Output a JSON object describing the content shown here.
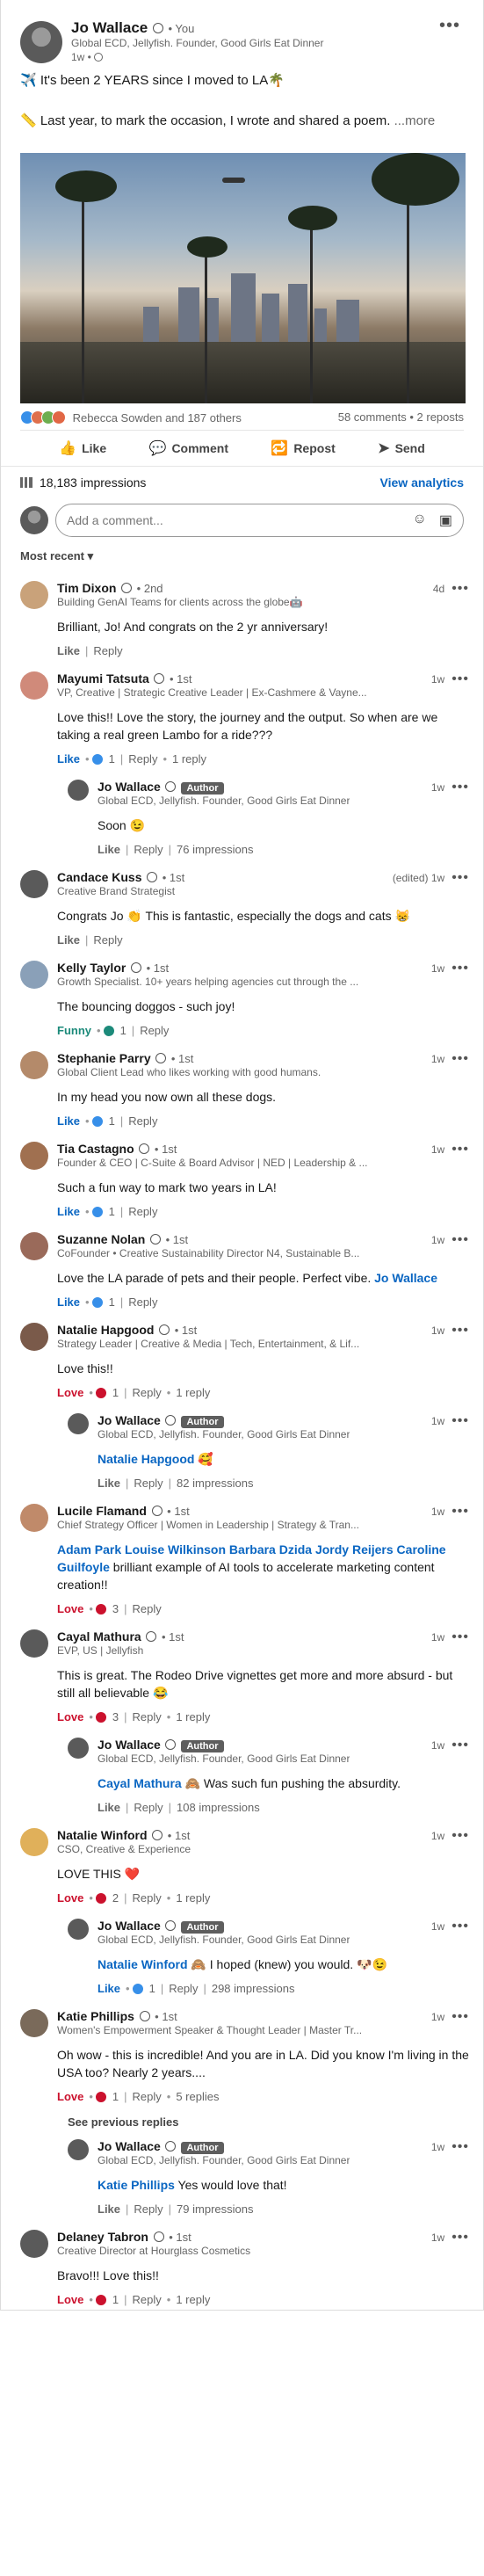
{
  "post": {
    "author": "Jo Wallace",
    "you": "• You",
    "headline": "Global ECD, Jellyfish. Founder, Good Girls Eat Dinner",
    "time": "1w •",
    "line1": "✈️ It's been 2 YEARS since I moved to LA🌴",
    "line2": "📏 Last year, to mark the occasion, I wrote and shared a poem.",
    "more": "...more",
    "reactions_text": "Rebecca Sowden and 187 others",
    "comments_reposts": "58 comments • 2 reposts",
    "actions": {
      "like": "Like",
      "comment": "Comment",
      "repost": "Repost",
      "send": "Send"
    },
    "impressions": "18,183 impressions",
    "view_analytics": "View analytics",
    "add_comment_placeholder": "Add a comment...",
    "sort": "Most recent ▾"
  },
  "colors": {
    "accent": "#0a66c2",
    "love": "#cb112d"
  },
  "comments": [
    {
      "name": "Tim Dixon",
      "deg": "• 2nd",
      "headline": "Building GenAI Teams for clients across the globe🤖",
      "time": "4d",
      "text": "Brilliant, Jo! And congrats on the 2 yr anniversary!",
      "react": "Like",
      "reply": "Reply"
    },
    {
      "name": "Mayumi Tatsuta",
      "deg": "• 1st",
      "headline": "VP, Creative | Strategic Creative Leader | Ex-Cashmere & Vayne...",
      "time": "1w",
      "text": "Love this!! Love the story, the journey and the output. So when are we taking a real green Lambo for a ride???",
      "react": "Like",
      "count": "1",
      "reply": "Reply",
      "replies": "1 reply"
    },
    {
      "name": "Jo Wallace",
      "badge": "Author",
      "headline": "Global ECD, Jellyfish. Founder, Good Girls Eat Dinner",
      "time": "1w",
      "text": "Soon 😉",
      "react": "Like",
      "reply": "Reply",
      "impressions": "76 impressions"
    },
    {
      "name": "Candace Kuss",
      "deg": "• 1st",
      "headline": "Creative Brand Strategist",
      "time": "(edited) 1w",
      "text": "Congrats Jo 👏 This is fantastic, especially the dogs and cats 😸",
      "react": "Like",
      "reply": "Reply"
    },
    {
      "name": "Kelly Taylor",
      "deg": "• 1st",
      "headline": "Growth Specialist. 10+ years helping agencies cut through the ...",
      "time": "1w",
      "text": "The bouncing doggos - such joy!",
      "react": "Funny",
      "count": "1",
      "reply": "Reply"
    },
    {
      "name": "Stephanie Parry",
      "deg": "• 1st",
      "headline": "Global Client Lead who likes working with good humans.",
      "time": "1w",
      "text": "In my head you now own all these dogs.",
      "react": "Like",
      "count": "1",
      "reply": "Reply"
    },
    {
      "name": "Tia Castagno",
      "deg": "• 1st",
      "headline": "Founder & CEO | C-Suite & Board Advisor | NED | Leadership & ...",
      "time": "1w",
      "text": "Such a fun way to mark two years in LA!",
      "react": "Like",
      "count": "1",
      "reply": "Reply"
    },
    {
      "name": "Suzanne Nolan",
      "deg": "• 1st",
      "headline": "CoFounder • Creative Sustainability Director N4, Sustainable B...",
      "time": "1w",
      "text": "Love the LA parade of pets and their people. Perfect vibe.",
      "mention": "Jo Wallace",
      "react": "Like",
      "count": "1",
      "reply": "Reply"
    },
    {
      "name": "Natalie Hapgood",
      "deg": "• 1st",
      "headline": "Strategy Leader | Creative & Media | Tech, Entertainment, & Lif...",
      "time": "1w",
      "text": "Love this!!",
      "react": "Love",
      "count": "1",
      "reply": "Reply",
      "replies": "1 reply"
    },
    {
      "name": "Jo Wallace",
      "badge": "Author",
      "headline": "Global ECD, Jellyfish. Founder, Good Girls Eat Dinner",
      "time": "1w",
      "mention": "Natalie Hapgood",
      "text": " 🥰",
      "react": "Like",
      "reply": "Reply",
      "impressions": "82 impressions"
    },
    {
      "name": "Lucile Flamand",
      "deg": "• 1st",
      "headline": "Chief Strategy Officer | Women in Leadership | Strategy & Tran...",
      "time": "1w",
      "mention": "Adam Park Louise Wilkinson Barbara Dzida Jordy Reijers Caroline Guilfoyle",
      "text": " brilliant example of AI tools to accelerate marketing content creation!!",
      "react": "Love",
      "count": "3",
      "reply": "Reply"
    },
    {
      "name": "Cayal Mathura",
      "deg": "• 1st",
      "headline": "EVP, US | Jellyfish",
      "time": "1w",
      "text": "This is great. The Rodeo Drive vignettes get more and more absurd - but still all believable 😂",
      "react": "Love",
      "count": "3",
      "reply": "Reply",
      "replies": "1 reply"
    },
    {
      "name": "Jo Wallace",
      "badge": "Author",
      "headline": "Global ECD, Jellyfish. Founder, Good Girls Eat Dinner",
      "time": "1w",
      "mention": "Cayal Mathura",
      "text": " 🙈 Was such fun pushing the absurdity.",
      "react": "Like",
      "reply": "Reply",
      "impressions": "108 impressions"
    },
    {
      "name": "Natalie Winford",
      "deg": "• 1st",
      "headline": "CSO, Creative & Experience",
      "time": "1w",
      "text": "LOVE THIS ❤️",
      "react": "Love",
      "count": "2",
      "reply": "Reply",
      "replies": "1 reply"
    },
    {
      "name": "Jo Wallace",
      "badge": "Author",
      "headline": "Global ECD, Jellyfish. Founder, Good Girls Eat Dinner",
      "time": "1w",
      "mention": "Natalie Winford",
      "text": " 🙈 I hoped (knew) you would. 🐶😉",
      "react": "Like",
      "count": "1",
      "reply": "Reply",
      "impressions": "298 impressions"
    },
    {
      "name": "Katie Phillips",
      "deg": "• 1st",
      "headline": "Women's Empowerment Speaker & Thought Leader | Master Tr...",
      "time": "1w",
      "text": "Oh wow - this is incredible! And you are in LA. Did you know I'm living in the USA too? Nearly 2 years....",
      "react": "Love",
      "count": "1",
      "reply": "Reply",
      "replies": "5 replies"
    },
    {
      "see_previous": "See previous replies"
    },
    {
      "name": "Jo Wallace",
      "badge": "Author",
      "headline": "Global ECD, Jellyfish. Founder, Good Girls Eat Dinner",
      "time": "1w",
      "mention": "Katie Phillips",
      "text": " Yes would love that!",
      "react": "Like",
      "reply": "Reply",
      "impressions": "79 impressions"
    },
    {
      "name": "Delaney Tabron",
      "deg": "• 1st",
      "headline": "Creative Director at Hourglass Cosmetics",
      "time": "1w",
      "text": "Bravo!!! Love this!!",
      "react": "Love",
      "count": "1",
      "reply": "Reply",
      "replies": "1 reply"
    }
  ]
}
